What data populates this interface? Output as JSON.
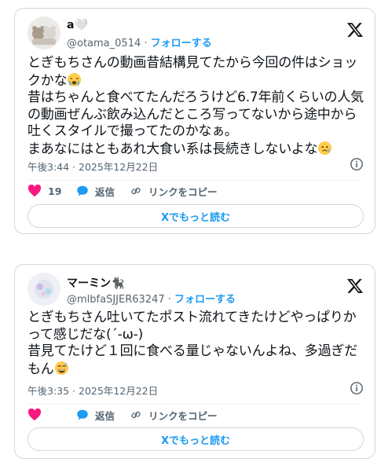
{
  "posts": [
    {
      "author_name": "a🤍",
      "handle": "@otama_0514",
      "separator": "·",
      "follow_label": "フォローする",
      "text_lines": [
        "とぎもちさんの動画昔結構見てたから今回の件はショッ",
        "クかな",
        "昔はちゃんと食べてたんだろうけど6.7年前くらいの人気",
        "の動画ぜんぶ飲み込んだところ写ってないから途中から",
        "吐くスタイルで撮ってたのかなぁ。",
        "まあなにはともあれ大食い系は長続きしないよな"
      ],
      "timestamp": "午後3:44 · 2025年12月22日",
      "like_count": "19",
      "reply_label": "返信",
      "copy_link_label": "リンクをコピー",
      "read_more_label": "Xでもっと読む"
    },
    {
      "author_name": "マーミン🐈‍⬛",
      "handle": "@mlbfaSJJER63247",
      "separator": "·",
      "follow_label": "フォローする",
      "text_lines": [
        "とぎもちさん吐いてたポスト流れてきたけどやっぱりか",
        "って感じだな(´-ω-)",
        "昔見てたけど１回に食べる量じゃないんよね、多過ぎだ",
        "もん"
      ],
      "timestamp": "午後3:35 · 2025年12月22日",
      "reply_label": "返信",
      "copy_link_label": "リンクをコピー",
      "read_more_label": "Xでもっと読む"
    }
  ],
  "colors": {
    "accent": "#1d9bf0",
    "like": "#f91880",
    "muted": "#536471",
    "border": "#cfd9de"
  },
  "icons": [
    "x-logo-icon",
    "info-icon",
    "heart-icon",
    "reply-bubble-icon",
    "link-icon",
    "crying-face-emoji",
    "worried-face-emoji",
    "grinning-sweat-emoji"
  ]
}
